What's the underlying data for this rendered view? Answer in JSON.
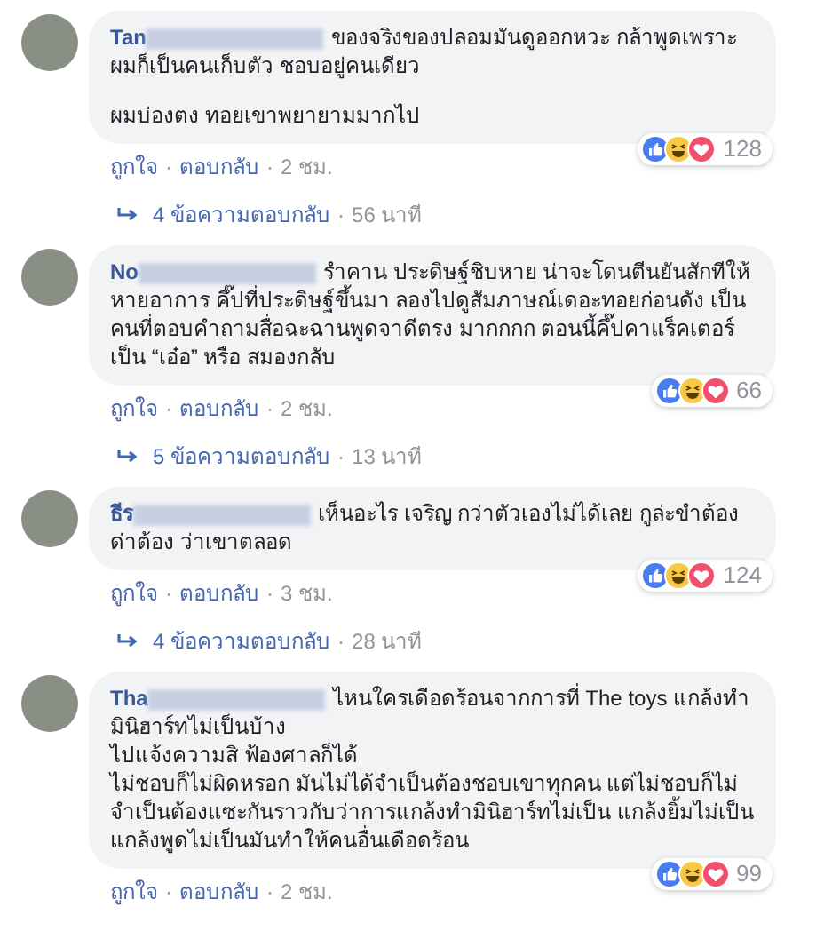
{
  "comments": [
    {
      "name": "Tan",
      "paragraphs": [
        "ของจริงของปลอมมันดูออกหวะ กล้าพูดเพราะผมก็เป็นคนเก็บตัว ชอบอยู่คนเดียว",
        "ผมบ่องตง ทอยเขาพยายามมากไป"
      ],
      "reaction_count": "128",
      "meta": [
        {
          "kind": "link",
          "text": "ถูกใจ"
        },
        {
          "kind": "dot",
          "text": "·"
        },
        {
          "kind": "link",
          "text": "ตอบกลับ"
        },
        {
          "kind": "dot",
          "text": "·"
        },
        {
          "kind": "time",
          "text": "2 ชม."
        }
      ],
      "replies": [
        {
          "kind": "link",
          "text": "4 ข้อความตอบกลับ"
        },
        {
          "kind": "dot",
          "text": "·"
        },
        {
          "kind": "time",
          "text": "56 นาที"
        }
      ]
    },
    {
      "name": "No",
      "paragraphs": [
        "รำคาน ประดิษฐ์ชิบหาย น่าจะโดนตีนยันสักทีให้หายอาการ คึ๊ปที่ประดิษฐ์ขึ้นมา ลองไปดูสัมภาษณ์เดอะทอยก่อนดัง เป็นคนที่ตอบคำถามสื่อฉะฉานพูดจาดีตรง มากกกก ตอนนี้คึ๊ปคาแร็คเตอร์เป็น “เอ๋อ” หรือ สมองกลับ"
      ],
      "reaction_count": "66",
      "meta": [
        {
          "kind": "link",
          "text": "ถูกใจ"
        },
        {
          "kind": "dot",
          "text": "·"
        },
        {
          "kind": "link",
          "text": "ตอบกลับ"
        },
        {
          "kind": "dot",
          "text": "·"
        },
        {
          "kind": "time",
          "text": "2 ชม."
        }
      ],
      "replies": [
        {
          "kind": "link",
          "text": "5 ข้อความตอบกลับ"
        },
        {
          "kind": "dot",
          "text": "·"
        },
        {
          "kind": "time",
          "text": "13 นาที"
        }
      ]
    },
    {
      "name": "ธีร",
      "paragraphs": [
        "เห็นอะไร เจริญ กว่าตัวเองไม่ได้เลย กูล่ะขำต้องด่าต้อง ว่าเขาตลอด"
      ],
      "reaction_count": "124",
      "meta": [
        {
          "kind": "link",
          "text": "ถูกใจ"
        },
        {
          "kind": "dot",
          "text": "·"
        },
        {
          "kind": "link",
          "text": "ตอบกลับ"
        },
        {
          "kind": "dot",
          "text": "·"
        },
        {
          "kind": "time",
          "text": "3 ชม."
        }
      ],
      "replies": [
        {
          "kind": "link",
          "text": "4 ข้อความตอบกลับ"
        },
        {
          "kind": "dot",
          "text": "·"
        },
        {
          "kind": "time",
          "text": "28 นาที"
        }
      ]
    },
    {
      "name": "Tha",
      "paragraphs": [
        "ไหนใครเดือดร้อนจากการที่ The toys แกล้งทำมินิฮาร์ทไม่เป็นบ้าง\nไปแจ้งความสิ ฟ้องศาลก็ได้\nไม่ชอบก็ไม่ผิดหรอก มันไม่ได้จำเป็นต้องชอบเขาทุกคน แต่ไม่ชอบก็ไม่จำเป็นต้องแซะกันราวกับว่าการแกล้งทำมินิฮาร์ทไม่เป็น แกล้งยิ้มไม่เป็น แกล้งพูดไม่เป็นมันทำให้คนอื่นเดือดร้อน"
      ],
      "reaction_count": "99",
      "meta": [
        {
          "kind": "link",
          "text": "ถูกใจ"
        },
        {
          "kind": "dot",
          "text": "·"
        },
        {
          "kind": "link",
          "text": "ตอบกลับ"
        },
        {
          "kind": "dot",
          "text": "·"
        },
        {
          "kind": "time",
          "text": "2 ชม."
        }
      ]
    }
  ]
}
